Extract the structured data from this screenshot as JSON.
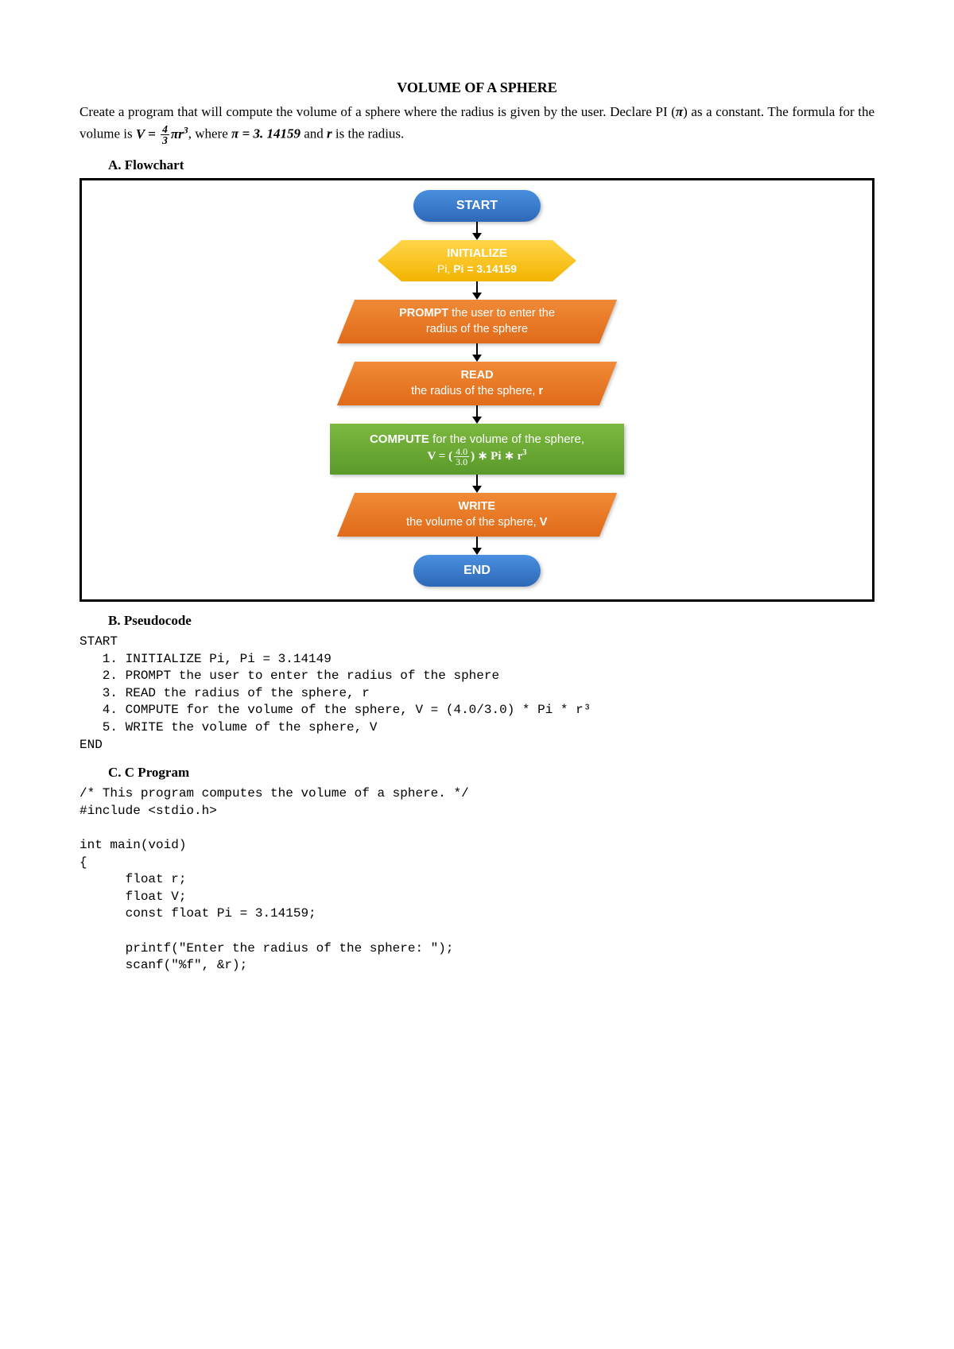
{
  "title": "VOLUME OF A SPHERE",
  "intro_part1": "Create a program that will compute the volume of a sphere where the radius is given by the user. Declare PI (",
  "intro_pi": "π",
  "intro_part2": ") as a constant. The formula for the volume is ",
  "formula_v": "V = ",
  "frac_n": "4",
  "frac_d": "3",
  "formula_tail": "πr",
  "formula_exp": "3",
  "intro_part3": ", where ",
  "pi_eq": "π = 3. 14159",
  "intro_part4": " and ",
  "r_sym": "r",
  "intro_part5": " is the radius.",
  "sectionA": "A.  Flowchart",
  "sectionB": "B.  Pseudocode",
  "sectionC": "C.  C Program",
  "flow": {
    "start": "START",
    "init1": "INITIALIZE",
    "init2_a": "Pi, ",
    "init2_b": "Pi = 3.14159",
    "prompt1": "PROMPT",
    "prompt2": " the user to enter the",
    "prompt3": "radius of the sphere",
    "read1": "READ",
    "read2_a": "the radius of the sphere, ",
    "read2_b": "r",
    "compute1": "COMPUTE",
    "compute1b": " for the volume of the sphere,",
    "compute2a": "V = (",
    "compute_frac_n": "4.0",
    "compute_frac_d": "3.0",
    "compute2b": ") ∗ Pi ∗ r",
    "compute2c": "3",
    "write1": "WRITE",
    "write2_a": "the volume of the sphere, ",
    "write2_b": "V",
    "end": "END"
  },
  "pseudo": "START\n   1. INITIALIZE Pi, Pi = 3.14149\n   2. PROMPT the user to enter the radius of the sphere\n   3. READ the radius of the sphere, r\n   4. COMPUTE for the volume of the sphere, V = (4.0/3.0) * Pi * r³\n   5. WRITE the volume of the sphere, V\nEND",
  "cprog": "/* This program computes the volume of a sphere. */\n#include <stdio.h>\n\nint main(void)\n{\n      float r;\n      float V;\n      const float Pi = 3.14159;\n\n      printf(\"Enter the radius of the sphere: \");\n      scanf(\"%f\", &r);"
}
